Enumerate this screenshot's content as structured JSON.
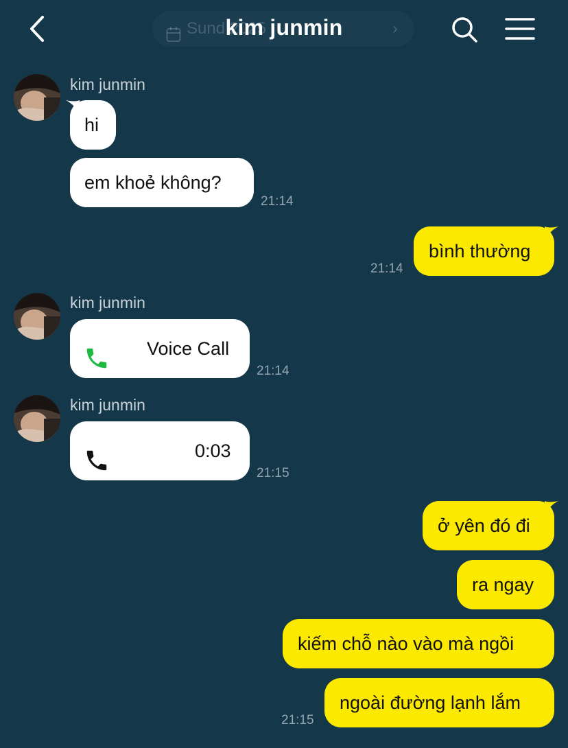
{
  "header": {
    "title": "kim junmin",
    "date_text": "Sund         2025",
    "date_chevron": "›"
  },
  "icons": {
    "back": "back-arrow-icon",
    "search": "search-icon",
    "menu": "hamburger-menu-icon",
    "calendar": "calendar-icon",
    "phone_green": "phone-icon",
    "phone_black": "phone-icon"
  },
  "colors": {
    "background": "#15374a",
    "incoming_bubble": "#ffffff",
    "outgoing_bubble": "#fce900",
    "call_icon_green": "#1fb941"
  },
  "messages": {
    "g1_sender": "kim junmin",
    "m1": "hi",
    "m2": "em khoẻ không?",
    "m2_time": "21:14",
    "m3": "bình thường",
    "m3_time": "21:14",
    "g2_sender": "kim junmin",
    "call1_label": "Voice Call",
    "call1_time": "21:14",
    "g3_sender": "kim junmin",
    "call2_duration": "0:03",
    "call2_time": "21:15",
    "m4": "ở yên đó đi",
    "m5": "ra ngay",
    "m6": "kiếm chỗ nào vào mà ngồi",
    "m7": "ngoài đường lạnh lắm",
    "m7_time": "21:15"
  }
}
